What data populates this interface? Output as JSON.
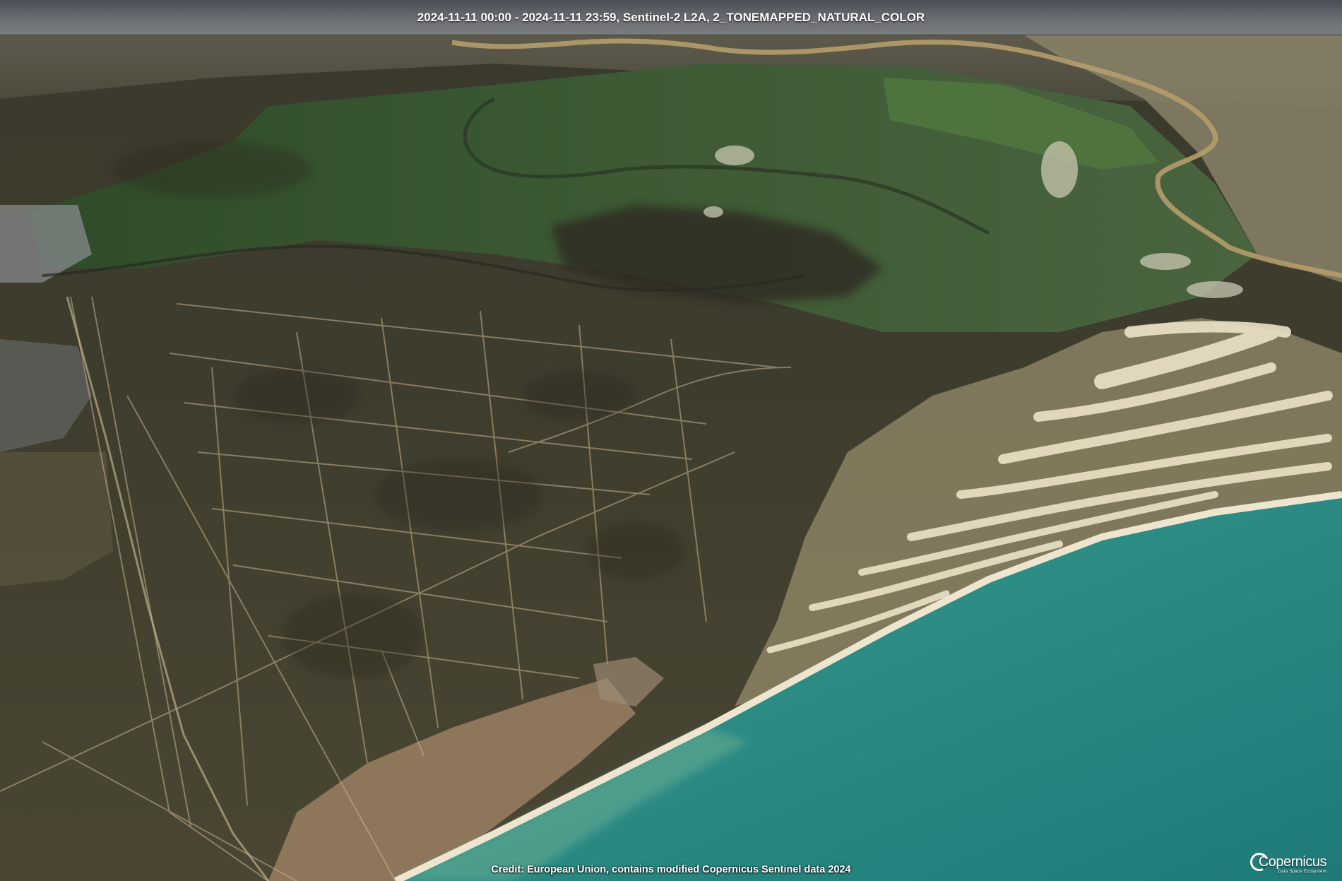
{
  "banner": {
    "text": "2024-11-11 00:00 - 2024-11-11 23:59, Sentinel-2 L2A, 2_TONEMAPPED_NATURAL_COLOR"
  },
  "credit": {
    "text": "Credit: European Union, contains modified Copernicus Sentinel data 2024"
  },
  "logo": {
    "name": "Copernicus",
    "subtitle": "Data Space Ecosystem"
  },
  "colors": {
    "sea": "#2a8a84",
    "sea_shallow": "#5aa896",
    "sand": "#e8dcc0",
    "forest": "#3d3f2c",
    "marsh": "#3f5a33",
    "river": "#b59c6a"
  }
}
